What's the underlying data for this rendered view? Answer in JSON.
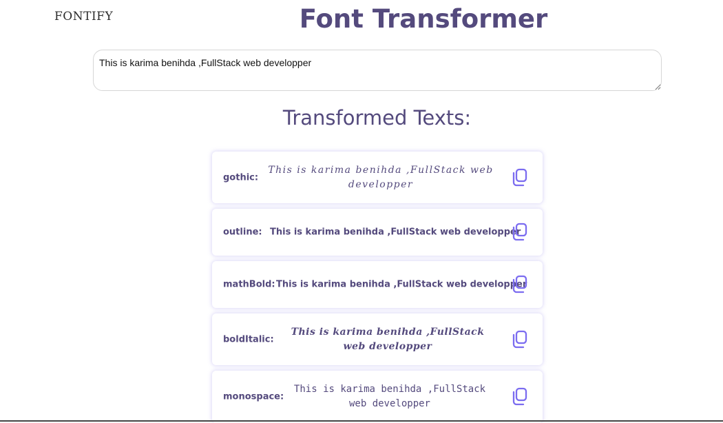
{
  "header": {
    "logo": "FONTIFY",
    "title": "Font Transformer"
  },
  "input": {
    "value": "This is karima benihda ,FullStack web developper"
  },
  "results": {
    "heading": "Transformed Texts:",
    "items": [
      {
        "label": "gothic:",
        "text": "This is karima benihda ,FullStack web developper",
        "copy_icon": "copy-icon"
      },
      {
        "label": "outline:",
        "text": "This is karima benihda ,FullStack web developper",
        "copy_icon": "copy-icon"
      },
      {
        "label": "mathBold:",
        "text": "This is karima benihda ,FullStack web developper",
        "copy_icon": "copy-icon"
      },
      {
        "label": "boldItalic:",
        "text": "This is karima benihda ,FullStack web developper",
        "copy_icon": "copy-icon"
      },
      {
        "label": "monospace:",
        "text": "This is karima benihda ,FullStack web developper",
        "copy_icon": "copy-icon"
      }
    ]
  },
  "colors": {
    "title": "#544a7d",
    "accent_icon": "#7b6cf0"
  }
}
